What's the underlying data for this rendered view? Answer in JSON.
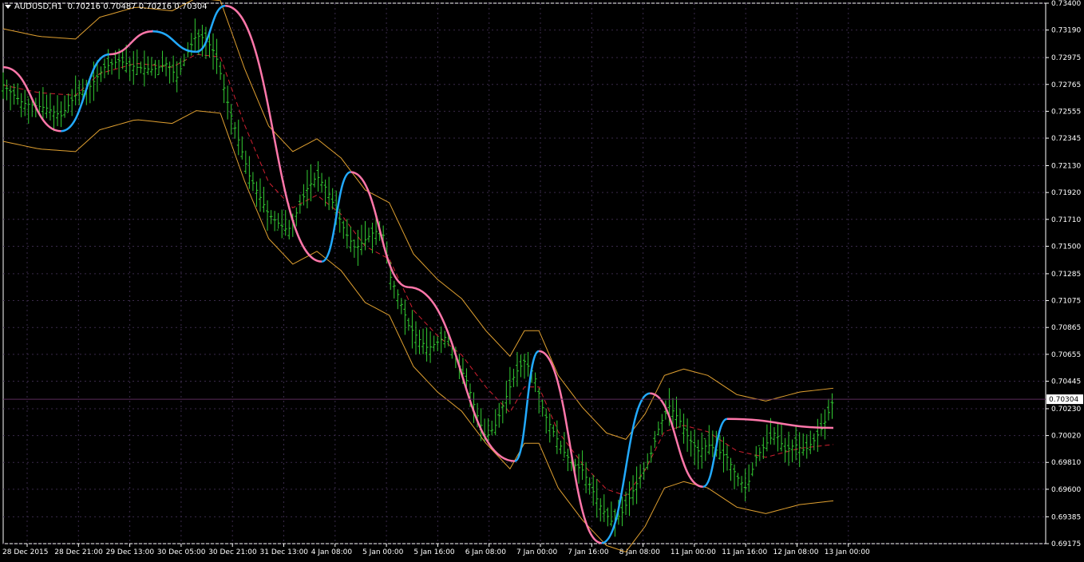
{
  "header": {
    "symbol": "AUDUSD,H1",
    "ohlc": "0.70216 0.70487 0.70216 0.70304"
  },
  "colors": {
    "background": "#000000",
    "grid": "#3a2a4a",
    "bars": "#33cc33",
    "band": "#e0a030",
    "midline": "#d02030",
    "trend_up": "#22aaff",
    "trend_down": "#ff77aa",
    "price_line": "#5a2a5a",
    "text": "#ffffff"
  },
  "chart_data": {
    "type": "ohlc",
    "ylim": [
      0.69175,
      0.734
    ],
    "price_ticks": [
      "0.73400",
      "0.73190",
      "0.72975",
      "0.72765",
      "0.72555",
      "0.72345",
      "0.72130",
      "0.71920",
      "0.71710",
      "0.71500",
      "0.71285",
      "0.71075",
      "0.70865",
      "0.70655",
      "0.70445",
      "0.70230",
      "0.70020",
      "0.69810",
      "0.69600",
      "0.69385",
      "0.69175"
    ],
    "time_ticks": [
      "28 Dec 2015",
      "28 Dec 21:00",
      "29 Dec 13:00",
      "30 Dec 05:00",
      "30 Dec 21:00",
      "31 Dec 13:00",
      "4 Jan 08:00",
      "5 Jan 00:00",
      "5 Jan 16:00",
      "6 Jan 08:00",
      "7 Jan 00:00",
      "7 Jan 16:00",
      "8 Jan 08:00",
      "11 Jan 00:00",
      "11 Jan 16:00",
      "12 Jan 08:00",
      "13 Jan 00:00"
    ],
    "current_price": "0.70304",
    "bar_count": 232,
    "close_path": [
      [
        0,
        0.7276
      ],
      [
        8,
        0.7262
      ],
      [
        18,
        0.7258
      ],
      [
        24,
        0.7252
      ],
      [
        30,
        0.7268
      ],
      [
        36,
        0.7275
      ],
      [
        42,
        0.729
      ],
      [
        48,
        0.7295
      ],
      [
        55,
        0.729
      ],
      [
        62,
        0.7288
      ],
      [
        68,
        0.7293
      ],
      [
        72,
        0.7282
      ],
      [
        76,
        0.73
      ],
      [
        80,
        0.7315
      ],
      [
        84,
        0.7312
      ],
      [
        88,
        0.73
      ],
      [
        90,
        0.7285
      ],
      [
        94,
        0.7255
      ],
      [
        98,
        0.723
      ],
      [
        102,
        0.7205
      ],
      [
        106,
        0.719
      ],
      [
        110,
        0.7175
      ],
      [
        114,
        0.7168
      ],
      [
        118,
        0.7162
      ],
      [
        122,
        0.7178
      ],
      [
        126,
        0.7195
      ],
      [
        130,
        0.7205
      ],
      [
        134,
        0.7195
      ],
      [
        138,
        0.7178
      ],
      [
        142,
        0.716
      ],
      [
        146,
        0.7148
      ],
      [
        150,
        0.7155
      ],
      [
        154,
        0.7162
      ],
      [
        158,
        0.7158
      ],
      [
        160,
        0.7128
      ],
      [
        164,
        0.711
      ],
      [
        168,
        0.7088
      ],
      [
        172,
        0.7078
      ],
      [
        176,
        0.707
      ],
      [
        180,
        0.7075
      ],
      [
        184,
        0.708
      ],
      [
        188,
        0.706
      ],
      [
        192,
        0.7045
      ],
      [
        196,
        0.702
      ],
      [
        200,
        0.7
      ],
      [
        204,
        0.701
      ],
      [
        208,
        0.703
      ],
      [
        212,
        0.705
      ],
      [
        216,
        0.706
      ],
      [
        220,
        0.705
      ],
      [
        224,
        0.702
      ],
      [
        228,
        0.7005
      ],
      [
        232,
        0.699
      ],
      [
        236,
        0.698
      ],
      [
        240,
        0.6975
      ],
      [
        244,
        0.696
      ],
      [
        248,
        0.6945
      ],
      [
        252,
        0.6935
      ],
      [
        256,
        0.694
      ],
      [
        260,
        0.6955
      ],
      [
        264,
        0.697
      ],
      [
        268,
        0.6985
      ],
      [
        272,
        0.701
      ],
      [
        276,
        0.7025
      ],
      [
        280,
        0.7015
      ],
      [
        284,
        0.7
      ],
      [
        288,
        0.699
      ],
      [
        292,
        0.6995
      ],
      [
        296,
        0.699
      ],
      [
        300,
        0.6985
      ],
      [
        304,
        0.697
      ],
      [
        308,
        0.696
      ],
      [
        312,
        0.6985
      ],
      [
        316,
        0.6995
      ],
      [
        320,
        0.7005
      ],
      [
        324,
        0.699
      ],
      [
        328,
        0.6995
      ],
      [
        332,
        0.699
      ],
      [
        336,
        0.6998
      ],
      [
        340,
        0.701
      ],
      [
        344,
        0.703
      ]
    ],
    "midline_path": [
      [
        0,
        0.7276
      ],
      [
        15,
        0.727
      ],
      [
        30,
        0.7268
      ],
      [
        40,
        0.7285
      ],
      [
        55,
        0.7293
      ],
      [
        70,
        0.729
      ],
      [
        80,
        0.73
      ],
      [
        90,
        0.7298
      ],
      [
        100,
        0.7245
      ],
      [
        110,
        0.72
      ],
      [
        120,
        0.718
      ],
      [
        130,
        0.719
      ],
      [
        140,
        0.7175
      ],
      [
        150,
        0.715
      ],
      [
        160,
        0.714
      ],
      [
        170,
        0.71
      ],
      [
        180,
        0.708
      ],
      [
        190,
        0.7065
      ],
      [
        200,
        0.704
      ],
      [
        210,
        0.702
      ],
      [
        216,
        0.704
      ],
      [
        222,
        0.704
      ],
      [
        230,
        0.7005
      ],
      [
        240,
        0.698
      ],
      [
        250,
        0.696
      ],
      [
        258,
        0.6955
      ],
      [
        266,
        0.6975
      ],
      [
        274,
        0.7005
      ],
      [
        282,
        0.701
      ],
      [
        292,
        0.7005
      ],
      [
        304,
        0.699
      ],
      [
        316,
        0.6985
      ],
      [
        330,
        0.6992
      ],
      [
        344,
        0.6995
      ]
    ],
    "band_offset": 0.0044,
    "trend_segments": [
      {
        "dir": "down",
        "from": [
          0,
          0.729
        ],
        "to": [
          24,
          0.724
        ]
      },
      {
        "dir": "up",
        "from": [
          24,
          0.724
        ],
        "to": [
          44,
          0.73
        ]
      },
      {
        "dir": "down",
        "from": [
          44,
          0.73
        ],
        "to": [
          62,
          0.7318
        ]
      },
      {
        "dir": "up",
        "from": [
          62,
          0.7318
        ],
        "to": [
          80,
          0.7302
        ]
      },
      {
        "dir": "up",
        "from": [
          80,
          0.7302
        ],
        "to": [
          92,
          0.7338
        ]
      },
      {
        "dir": "down",
        "from": [
          92,
          0.7338
        ],
        "to": [
          132,
          0.7138
        ]
      },
      {
        "dir": "up",
        "from": [
          132,
          0.7138
        ],
        "to": [
          144,
          0.7208
        ]
      },
      {
        "dir": "down",
        "from": [
          144,
          0.7208
        ],
        "to": [
          168,
          0.7118
        ]
      },
      {
        "dir": "down",
        "from": [
          168,
          0.7118
        ],
        "to": [
          212,
          0.6982
        ]
      },
      {
        "dir": "up",
        "from": [
          212,
          0.6982
        ],
        "to": [
          222,
          0.7068
        ]
      },
      {
        "dir": "down",
        "from": [
          222,
          0.7068
        ],
        "to": [
          248,
          0.6918
        ]
      },
      {
        "dir": "up",
        "from": [
          248,
          0.6918
        ],
        "to": [
          268,
          0.7035
        ]
      },
      {
        "dir": "down",
        "from": [
          268,
          0.7035
        ],
        "to": [
          290,
          0.6962
        ]
      },
      {
        "dir": "up",
        "from": [
          290,
          0.6962
        ],
        "to": [
          300,
          0.7015
        ]
      },
      {
        "dir": "down",
        "from": [
          300,
          0.7015
        ],
        "to": [
          344,
          0.7008
        ]
      }
    ]
  }
}
